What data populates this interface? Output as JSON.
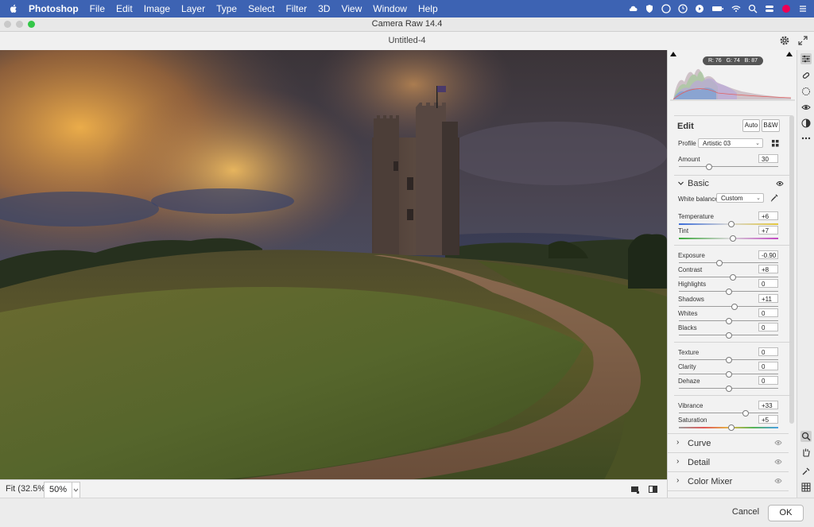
{
  "menubar": {
    "items": [
      "Photoshop",
      "File",
      "Edit",
      "Image",
      "Layer",
      "Type",
      "Select",
      "Filter",
      "3D",
      "View",
      "Window",
      "Help"
    ]
  },
  "window": {
    "title": "Camera Raw 14.4",
    "document": "Untitled-4"
  },
  "histogram": {
    "r": "R: 76",
    "g": "G: 74",
    "b": "B: 87"
  },
  "edit": {
    "title": "Edit",
    "auto_label": "Auto",
    "bw_label": "B&W",
    "profile_label": "Profile",
    "profile_value": "Artistic 03",
    "amount_label": "Amount",
    "amount_value": "30",
    "amount_level": 0.3
  },
  "basic": {
    "title": "Basic",
    "wb_label": "White balance",
    "wb_value": "Custom",
    "sliders": [
      {
        "label": "Temperature",
        "value": "+6",
        "level": 0.53
      },
      {
        "label": "Tint",
        "value": "+7",
        "level": 0.54
      },
      {
        "label": "Exposure",
        "value": "-0.90",
        "level": 0.41
      },
      {
        "label": "Contrast",
        "value": "+8",
        "level": 0.54
      },
      {
        "label": "Highlights",
        "value": "0",
        "level": 0.5
      },
      {
        "label": "Shadows",
        "value": "+11",
        "level": 0.56
      },
      {
        "label": "Whites",
        "value": "0",
        "level": 0.5
      },
      {
        "label": "Blacks",
        "value": "0",
        "level": 0.5
      },
      {
        "label": "Texture",
        "value": "0",
        "level": 0.5
      },
      {
        "label": "Clarity",
        "value": "0",
        "level": 0.5
      },
      {
        "label": "Dehaze",
        "value": "0",
        "level": 0.5
      },
      {
        "label": "Vibrance",
        "value": "+33",
        "level": 0.67
      },
      {
        "label": "Saturation",
        "value": "+5",
        "level": 0.53
      }
    ]
  },
  "sections": [
    "Curve",
    "Detail",
    "Color Mixer"
  ],
  "bottom": {
    "fit": "Fit (32.5%)",
    "zoom": "50%"
  },
  "footer": {
    "cancel": "Cancel",
    "ok": "OK"
  }
}
